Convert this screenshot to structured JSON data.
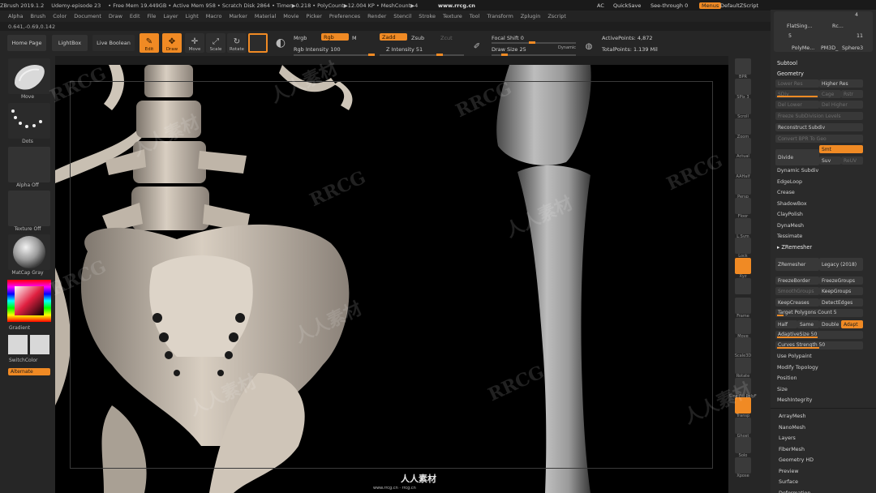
{
  "titlebar": {
    "items": [
      "ZBrush 2019.1.2",
      "Udemy-episode 23",
      "• Free Mem 19.449GB • Active Mem 958 • Scratch Disk 2864 • Timer▶0.218 • PolyCount▶12.004 KP • MeshCount▶4"
    ],
    "ac": "AC",
    "quicksave": "QuickSave",
    "see_through_label": "See-through",
    "see_through_value": "0",
    "menus_btn": "Menus",
    "default_script": "DefaultZScript",
    "watermark_url": "www.rrcg.cn"
  },
  "menubar": [
    "Alpha",
    "Brush",
    "Color",
    "Document",
    "Draw",
    "Edit",
    "File",
    "Layer",
    "Light",
    "Macro",
    "Marker",
    "Material",
    "Movie",
    "Picker",
    "Preferences",
    "Render",
    "Stencil",
    "Stroke",
    "Texture",
    "Tool",
    "Transform",
    "Zplugin",
    "Zscript"
  ],
  "coords": "0.641,-0.69,0.142",
  "shelf": {
    "home_page": "Home Page",
    "lightbox": "LightBox",
    "live_boolean": "Live Boolean",
    "tools": [
      {
        "label": "Edit",
        "glyph": "✎",
        "on": true
      },
      {
        "label": "Draw",
        "glyph": "✥",
        "on": true
      },
      {
        "label": "Move",
        "glyph": "✛",
        "on": false
      },
      {
        "label": "Scale",
        "glyph": "⤢",
        "on": false
      },
      {
        "label": "Rotate",
        "glyph": "↻",
        "on": false
      }
    ],
    "mrgb": "Mrgb",
    "rgb": "Rgb",
    "m": "M",
    "zadd": "Zadd",
    "zsub": "Zsub",
    "zcut": "Zcut",
    "rgb_intensity": "Rgb Intensity 100",
    "z_intensity": "Z Intensity 51",
    "focal_shift": "Focal Shift 0",
    "draw_size": "Draw Size 25",
    "dynamic": "Dynamic",
    "active_points": "ActivePoints: 4,872",
    "total_points": "TotalPoints: 1.139 Mil"
  },
  "leftpanel": {
    "brush": "Move",
    "stroke": "Dots",
    "alpha": "Alpha Off",
    "texture": "Texture Off",
    "material": "MatCap Gray",
    "gradient": "Gradient",
    "switch_color": "SwitchColor",
    "alternate": "Alternate"
  },
  "rtools": [
    {
      "label": "BPR",
      "on": false
    },
    {
      "label": "SPix 3",
      "on": false
    },
    {
      "label": "Scroll",
      "on": false
    },
    {
      "label": "Zoom",
      "on": false
    },
    {
      "label": "Actual",
      "on": false
    },
    {
      "label": "AAHalf",
      "on": false
    },
    {
      "label": "Persp",
      "on": false
    },
    {
      "label": "Floor",
      "on": false
    },
    {
      "label": "L.Sym",
      "on": false
    },
    {
      "label": "Lock",
      "on": false
    },
    {
      "label": "Xyz",
      "on": true
    },
    {
      "label": "",
      "on": false
    },
    {
      "label": "Frame",
      "on": false
    },
    {
      "label": "Move",
      "on": false
    },
    {
      "label": "Scale3D",
      "on": false
    },
    {
      "label": "Rotate",
      "on": false
    },
    {
      "label": "Line Fill PolyF",
      "on": false
    },
    {
      "label": "Transp",
      "on": true
    },
    {
      "label": "Ghost",
      "on": false
    },
    {
      "label": "Solo",
      "on": false
    },
    {
      "label": "Xpose",
      "on": false
    }
  ],
  "rpanel": {
    "top_thumbs": [
      "FlatSing...",
      "Rc...",
      "PolyMe...",
      "PM3D_",
      "Sphere3"
    ],
    "top_nums": [
      "4",
      "5",
      "11"
    ],
    "subtool": "Subtool",
    "geometry": "Geometry",
    "lower_res": "Lower Res",
    "higher_res": "Higher Res",
    "sdiv": "SDiv",
    "cage": "Cage",
    "rstr": "Rstr",
    "del_lower": "Del Lower",
    "del_higher": "Del Higher",
    "freeze_subdiv": "Freeze SubDivision Levels",
    "reconstruct": "Reconstruct Subdiv",
    "convert_bpr": "Convert BPR To Geo",
    "divide": "Divide",
    "smt": "Smt",
    "suv": "Suv",
    "reuv": "ReUV",
    "list1": [
      "Dynamic Subdiv",
      "EdgeLoop",
      "Crease",
      "ShadowBox",
      "ClayPolish",
      "DynaMesh",
      "Tessimate"
    ],
    "zremesher": "ZRemesher",
    "zremesher_btn": "ZRemesher",
    "legacy": "Legacy (2018)",
    "freeze_border": "FreezeBorder",
    "freeze_groups": "FreezeGroups",
    "smooth_groups": "SmoothGroups",
    "keep_groups": "KeepGroups",
    "keep_creases": "KeepCreases",
    "detect_edges": "DetectEdges",
    "target_count": "Target Polygons Count 5",
    "half": "Half",
    "same": "Same",
    "double": "Double",
    "adapt": "Adapt",
    "adaptive_size": "AdaptiveSize 50",
    "curves_strength": "Curves Strength 50",
    "list2": [
      "Use Polypaint",
      "Modify Topology",
      "Position",
      "Size",
      "MeshIntegrity"
    ],
    "list3": [
      "ArrayMesh",
      "NanoMesh",
      "Layers",
      "FiberMesh",
      "Geometry HD",
      "Preview",
      "Surface",
      "Deformation"
    ]
  },
  "watermark": {
    "marks": [
      "RRCG",
      "人人素材",
      "RRCG",
      "人人素材",
      "RRCG",
      "人人素材",
      "RRCG",
      "人人素材",
      "RRCG",
      "人人素材",
      "RRCG",
      "人人素材"
    ],
    "credit": "人人素材",
    "credit_url": "www.rrcg.cn  ·  rrcg.cn"
  },
  "colors": {
    "accent": "#f08a24",
    "panel": "#262626",
    "viewport": "#000000",
    "bone": "#d9cfc2"
  }
}
